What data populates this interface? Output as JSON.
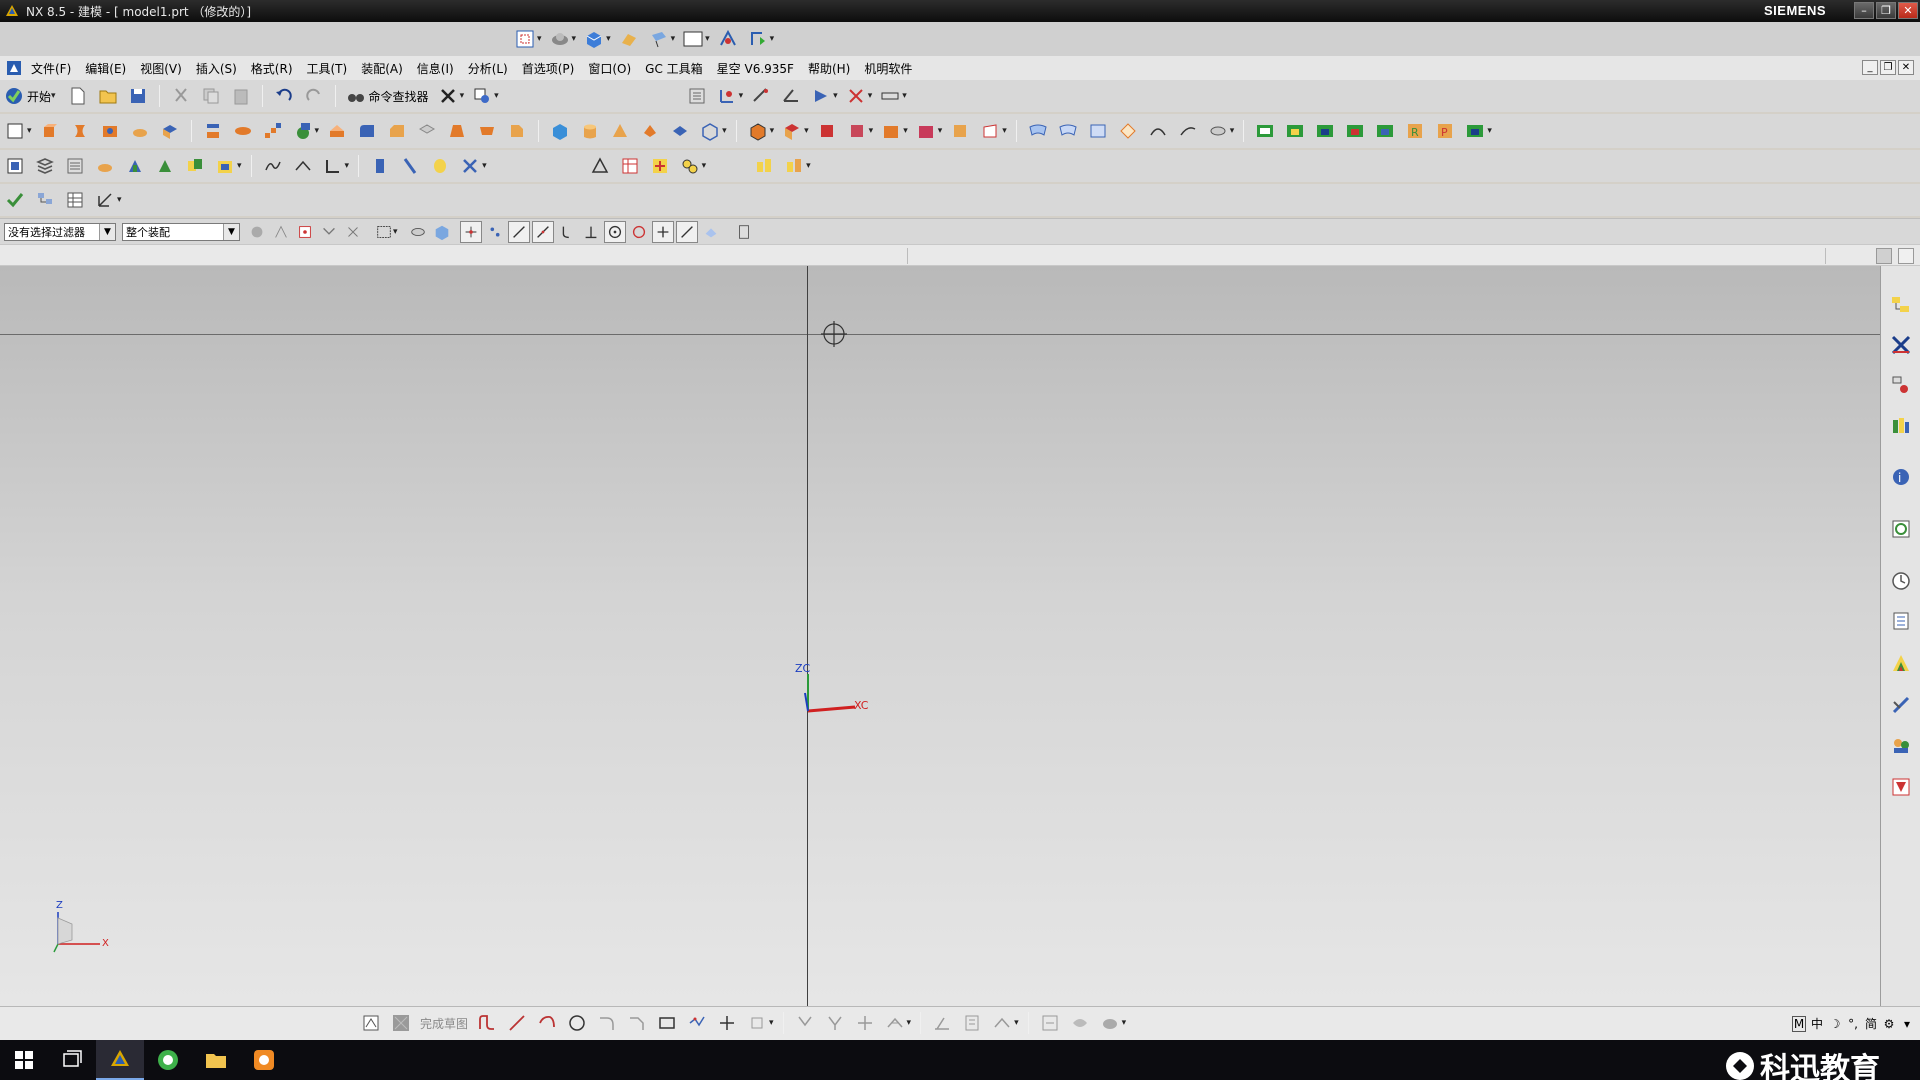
{
  "window": {
    "title": "NX 8.5 - 建模 - [ model1.prt （修改的）]",
    "brand": "SIEMENS",
    "min": "–",
    "restore": "❐",
    "close": "✕"
  },
  "menubar": {
    "items": [
      "文件(F)",
      "编辑(E)",
      "视图(V)",
      "插入(S)",
      "格式(R)",
      "工具(T)",
      "装配(A)",
      "信息(I)",
      "分析(L)",
      "首选项(P)",
      "窗口(O)",
      "GC 工具箱",
      "星空 V6.935F",
      "帮助(H)",
      "机明软件"
    ]
  },
  "standard_toolbar": {
    "start_label": "开始",
    "command_finder_label": "命令查找器"
  },
  "filterbar": {
    "type_filter": "没有选择过滤器",
    "scope_filter": "整个装配"
  },
  "graphics": {
    "wcs": {
      "z_label": "ZC",
      "x_label": "XC"
    },
    "triad": {
      "z_label": "Z",
      "x_label": "X"
    }
  },
  "sketch_bar": {
    "finish_label": "完成草图"
  },
  "status_tray": [
    "M",
    "中",
    "☽",
    "°,",
    "简",
    "⚙"
  ],
  "watermark": {
    "text": "科迅教育"
  },
  "colors": {
    "accent": "#cc2a20",
    "title_bg": "#0d0d0d",
    "graphics_top": "#b9b9b9",
    "graphics_bottom": "#e6e6e6"
  }
}
